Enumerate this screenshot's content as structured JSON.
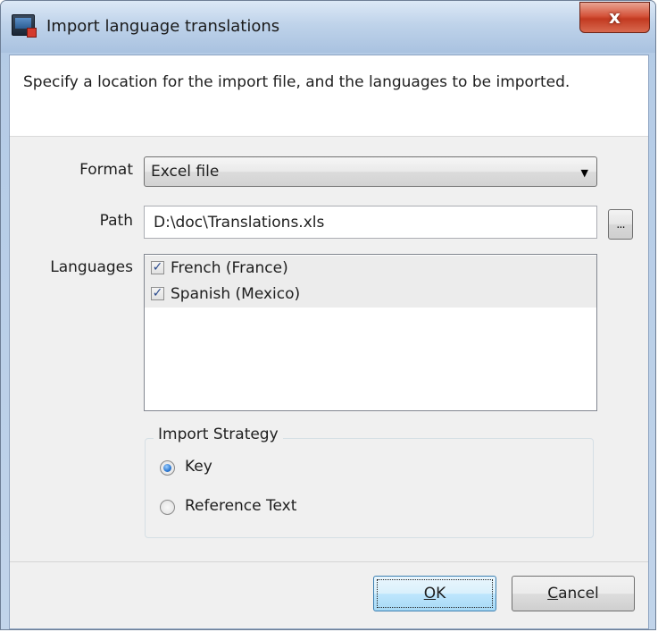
{
  "window": {
    "title": "Import language translations",
    "close_glyph": "x"
  },
  "header": {
    "instruction": "Specify a location for the import file, and the languages to be imported."
  },
  "form": {
    "format_label": "Format",
    "format_value": "Excel file",
    "path_label": "Path",
    "path_value": "D:\\doc\\Translations.xls",
    "browse_label": "...",
    "languages_label": "Languages",
    "languages": [
      {
        "label": "French (France)",
        "checked": true
      },
      {
        "label": "Spanish (Mexico)",
        "checked": true
      }
    ]
  },
  "strategy": {
    "title": "Import Strategy",
    "options": [
      {
        "label": "Key",
        "selected": true
      },
      {
        "label": "Reference Text",
        "selected": false
      }
    ]
  },
  "buttons": {
    "ok_mnemonic": "O",
    "ok_rest": "K",
    "cancel_mnemonic": "C",
    "cancel_rest": "ancel"
  },
  "icons": {
    "app": "application-icon",
    "checkbox": "checkmark-icon",
    "dropdown": "chevron-down-icon"
  }
}
